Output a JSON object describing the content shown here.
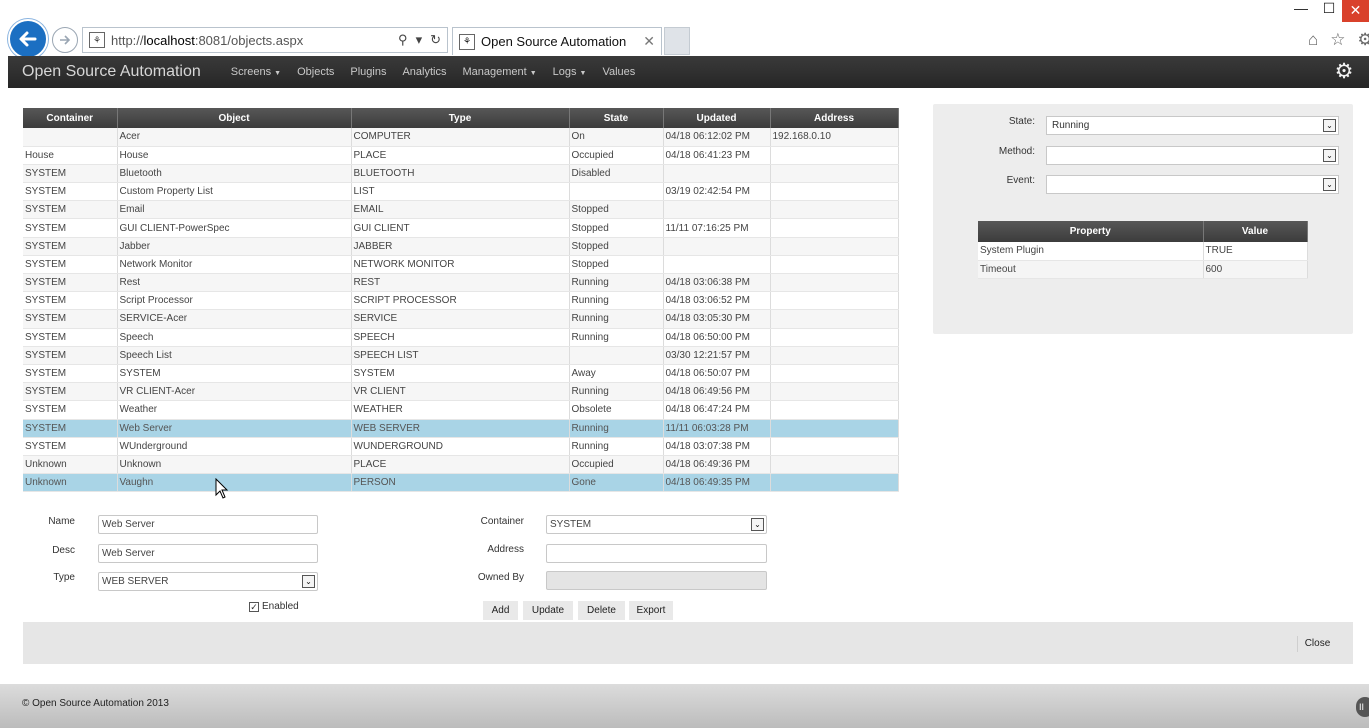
{
  "browser": {
    "url_prefix": "http://",
    "url_host": "localhost",
    "url_rest": ":8081/objects.aspx",
    "tab_title": "Open Source Automation",
    "min_icon": "—",
    "max_icon": "☐",
    "close_icon": "✕",
    "tab_close_icon": "✕",
    "search_icon": "⚲",
    "dropdown_icon": "▾",
    "refresh_icon": "↻",
    "home_icon": "⌂",
    "star_icon": "☆",
    "settings_icon": "⚙"
  },
  "app": {
    "brand": "Open Source Automation",
    "menu": [
      {
        "label": "Screens",
        "caret": true
      },
      {
        "label": "Objects",
        "caret": false
      },
      {
        "label": "Plugins",
        "caret": false
      },
      {
        "label": "Analytics",
        "caret": false
      },
      {
        "label": "Management",
        "caret": true
      },
      {
        "label": "Logs",
        "caret": true
      },
      {
        "label": "Values",
        "caret": false
      }
    ],
    "gear_icon": "⚙"
  },
  "objects_table": {
    "headers": [
      "Container",
      "Object",
      "Type",
      "State",
      "Updated",
      "Address"
    ],
    "rows": [
      [
        "",
        "Acer",
        "COMPUTER",
        "On",
        "04/18 06:12:02 PM",
        "192.168.0.10"
      ],
      [
        "House",
        "House",
        "PLACE",
        "Occupied",
        "04/18 06:41:23 PM",
        ""
      ],
      [
        "SYSTEM",
        "Bluetooth",
        "BLUETOOTH",
        "Disabled",
        "",
        ""
      ],
      [
        "SYSTEM",
        "Custom Property List",
        "LIST",
        "",
        "03/19 02:42:54 PM",
        ""
      ],
      [
        "SYSTEM",
        "Email",
        "EMAIL",
        "Stopped",
        "",
        ""
      ],
      [
        "SYSTEM",
        "GUI CLIENT-PowerSpec",
        "GUI CLIENT",
        "Stopped",
        "11/11 07:16:25 PM",
        ""
      ],
      [
        "SYSTEM",
        "Jabber",
        "JABBER",
        "Stopped",
        "",
        ""
      ],
      [
        "SYSTEM",
        "Network Monitor",
        "NETWORK MONITOR",
        "Stopped",
        "",
        ""
      ],
      [
        "SYSTEM",
        "Rest",
        "REST",
        "Running",
        "04/18 03:06:38 PM",
        ""
      ],
      [
        "SYSTEM",
        "Script Processor",
        "SCRIPT PROCESSOR",
        "Running",
        "04/18 03:06:52 PM",
        ""
      ],
      [
        "SYSTEM",
        "SERVICE-Acer",
        "SERVICE",
        "Running",
        "04/18 03:05:30 PM",
        ""
      ],
      [
        "SYSTEM",
        "Speech",
        "SPEECH",
        "Running",
        "04/18 06:50:00 PM",
        ""
      ],
      [
        "SYSTEM",
        "Speech List",
        "SPEECH LIST",
        "",
        "03/30 12:21:57 PM",
        ""
      ],
      [
        "SYSTEM",
        "SYSTEM",
        "SYSTEM",
        "Away",
        "04/18 06:50:07 PM",
        ""
      ],
      [
        "SYSTEM",
        "VR CLIENT-Acer",
        "VR CLIENT",
        "Running",
        "04/18 06:49:56 PM",
        ""
      ],
      [
        "SYSTEM",
        "Weather",
        "WEATHER",
        "Obsolete",
        "04/18 06:47:24 PM",
        ""
      ],
      [
        "SYSTEM",
        "Web Server",
        "WEB SERVER",
        "Running",
        "11/11 06:03:28 PM",
        ""
      ],
      [
        "SYSTEM",
        "WUnderground",
        "WUNDERGROUND",
        "Running",
        "04/18 03:07:38 PM",
        ""
      ],
      [
        "Unknown",
        "Unknown",
        "PLACE",
        "Occupied",
        "04/18 06:49:36 PM",
        ""
      ],
      [
        "Unknown",
        "Vaughn",
        "PERSON",
        "Gone",
        "04/18 06:49:35 PM",
        ""
      ]
    ],
    "selected_rows": [
      16,
      19
    ]
  },
  "form": {
    "name_label": "Name",
    "name_value": "Web Server",
    "desc_label": "Desc",
    "desc_value": "Web Server",
    "type_label": "Type",
    "type_value": "WEB SERVER",
    "enabled_label": "Enabled",
    "enabled_checked": "✓",
    "container_label": "Container",
    "container_value": "SYSTEM",
    "address_label": "Address",
    "address_value": "",
    "owned_by_label": "Owned By",
    "owned_by_value": "",
    "add": "Add",
    "update": "Update",
    "delete": "Delete",
    "export": "Export",
    "close": "Close"
  },
  "right_panel": {
    "state_label": "State:",
    "state_value": "Running",
    "method_label": "Method:",
    "method_value": "",
    "event_label": "Event:",
    "event_value": "",
    "prop_headers": [
      "Property",
      "Value"
    ],
    "props": [
      [
        "System Plugin",
        "TRUE"
      ],
      [
        "Timeout",
        "600"
      ]
    ]
  },
  "footer": {
    "copyright": "© Open Source Automation 2013"
  },
  "dropdown_arrow": "⌄",
  "colors": {
    "header_dark": "#2e2e2e",
    "selected_row": "#a9d4e6",
    "back_button": "#1b6fc2",
    "close_button": "#d9412b"
  }
}
